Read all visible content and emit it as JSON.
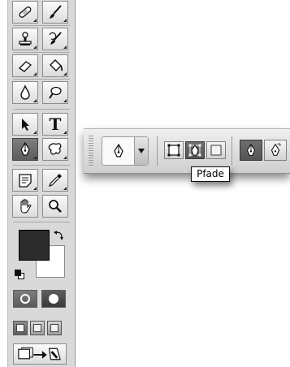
{
  "tools": [
    {
      "name": "healing-brush-tool",
      "icon": "bandage-icon"
    },
    {
      "name": "brush-tool",
      "icon": "brush-icon"
    },
    {
      "name": "clone-stamp-tool",
      "icon": "stamp-icon"
    },
    {
      "name": "history-brush-tool",
      "icon": "history-brush-icon"
    },
    {
      "name": "eraser-tool",
      "icon": "eraser-icon"
    },
    {
      "name": "paint-bucket-tool",
      "icon": "bucket-icon"
    },
    {
      "name": "blur-tool",
      "icon": "drop-icon"
    },
    {
      "name": "dodge-tool",
      "icon": "dodge-icon"
    },
    {
      "name": "path-selection-tool",
      "icon": "arrow-icon"
    },
    {
      "name": "type-tool",
      "icon": "type-icon",
      "label": "T"
    },
    {
      "name": "pen-tool",
      "icon": "pen-icon"
    },
    {
      "name": "custom-shape-tool",
      "icon": "shape-icon"
    },
    {
      "name": "notes-tool",
      "icon": "note-icon"
    },
    {
      "name": "eyedropper-tool",
      "icon": "eyedropper-icon"
    },
    {
      "name": "hand-tool",
      "icon": "hand-icon"
    },
    {
      "name": "zoom-tool",
      "icon": "magnifier-icon"
    }
  ],
  "colors": {
    "foreground": "#2b2b2b",
    "background": "#ffffff"
  },
  "options_bar": {
    "active_mode": "paths",
    "tooltip": "Pfade"
  }
}
